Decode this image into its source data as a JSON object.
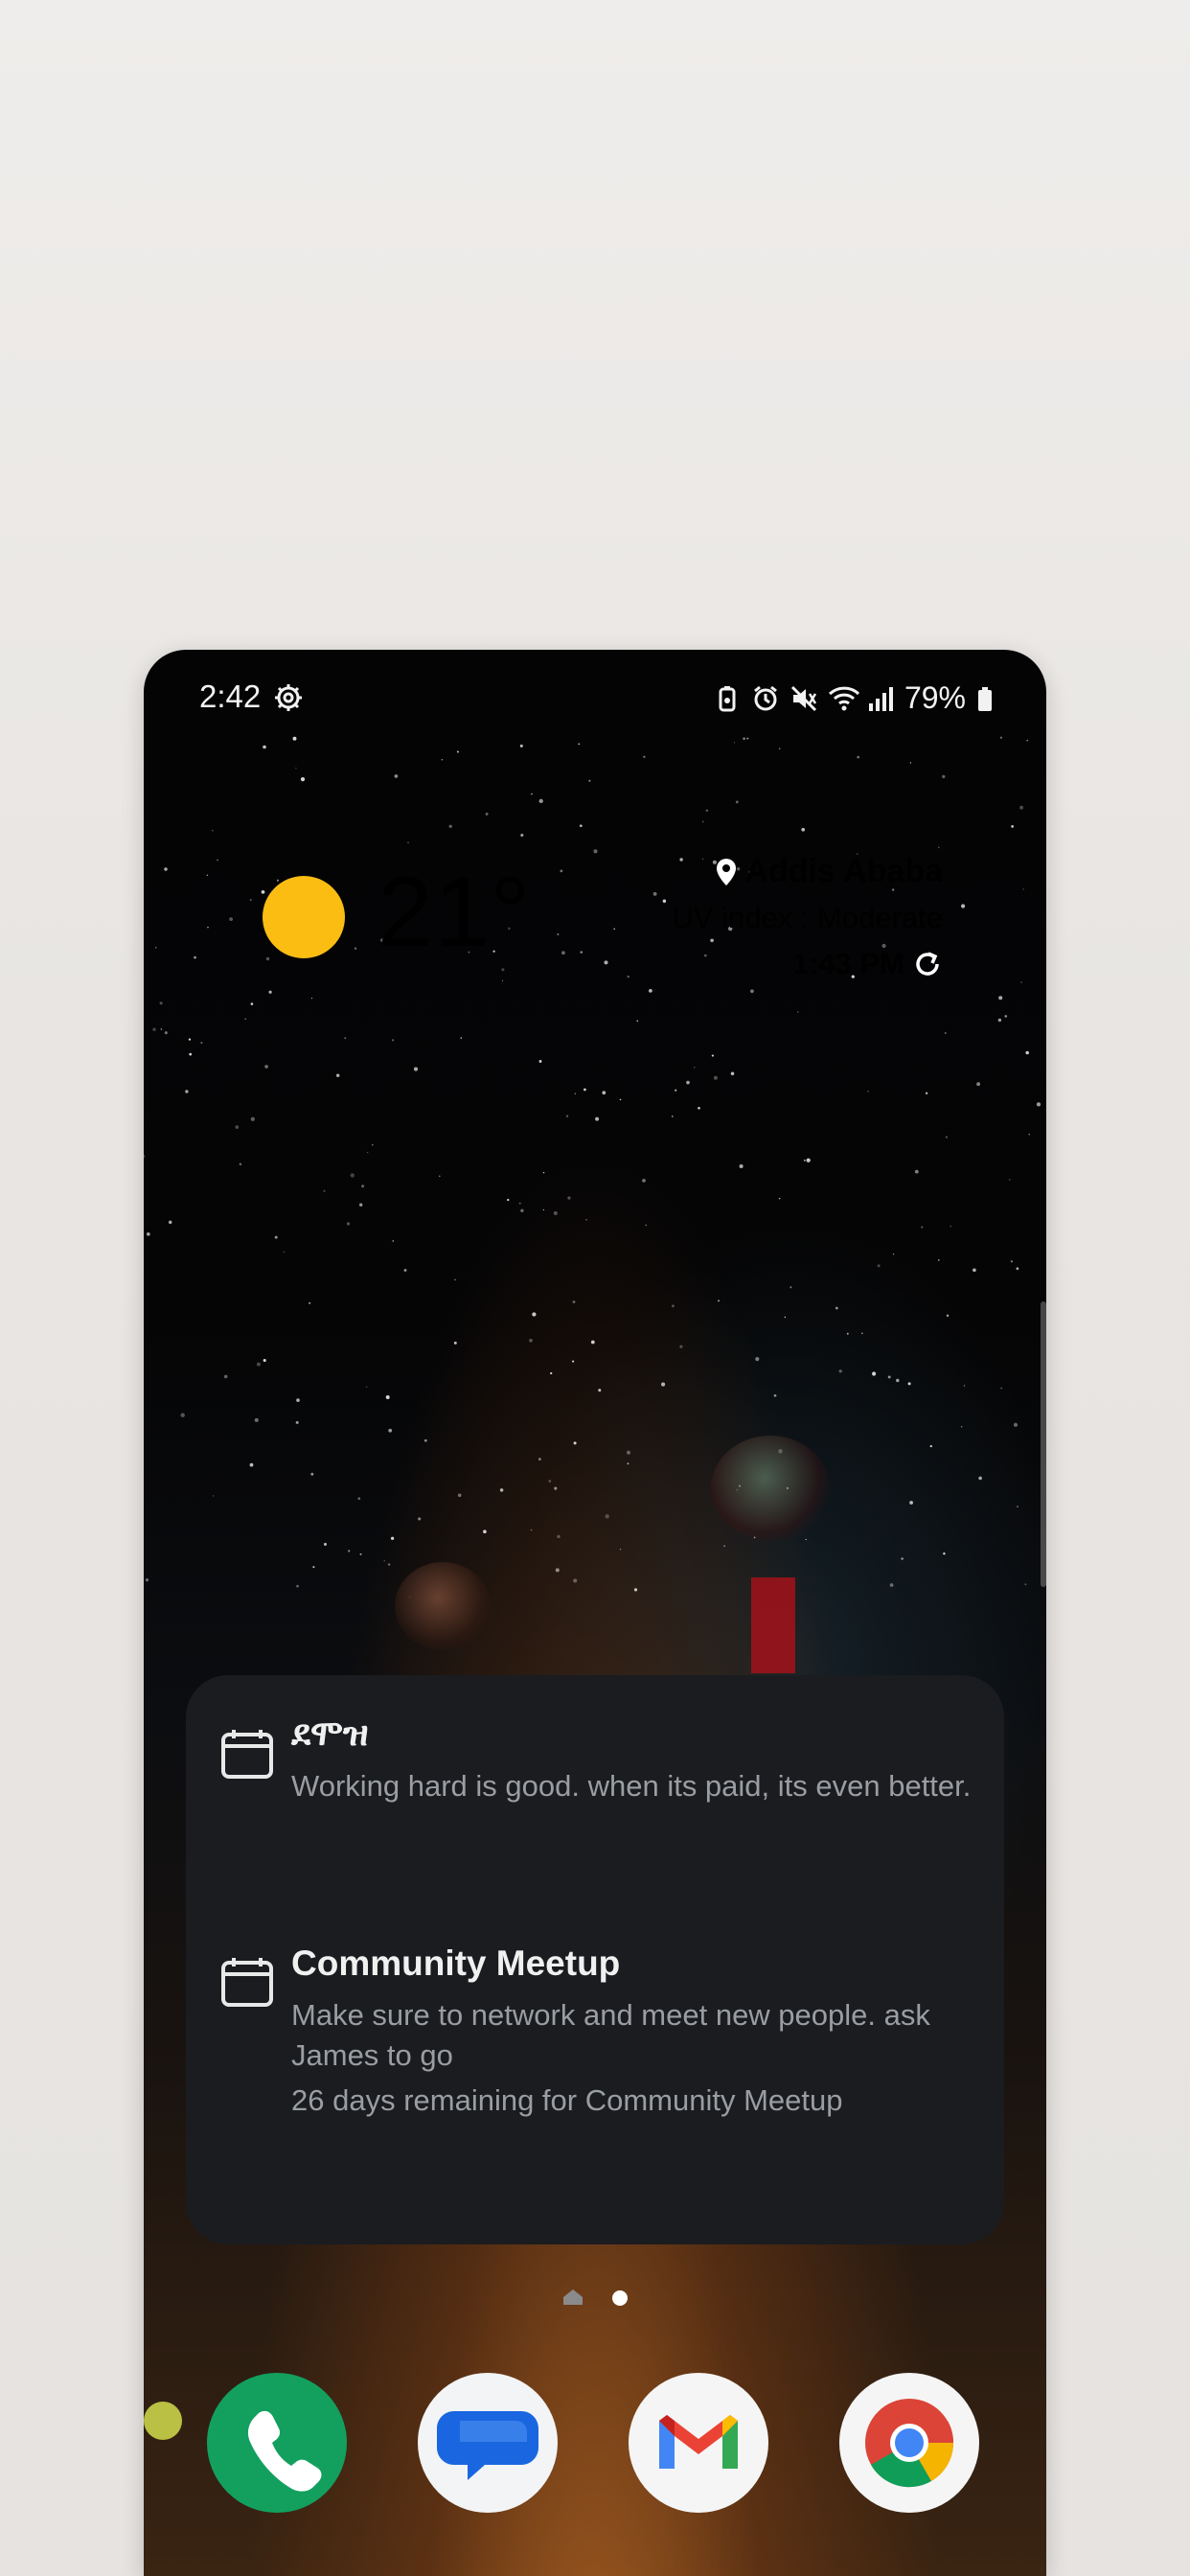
{
  "status_bar": {
    "time": "2:42",
    "battery_percent": "79%",
    "icons": [
      "settings-icon",
      "battery-saver-icon",
      "alarm-icon",
      "mute-icon",
      "wifi-icon",
      "signal-icon",
      "battery-icon"
    ]
  },
  "weather": {
    "temperature": "21°",
    "location": "Addis Ababa",
    "uv_index": "UV index : Moderate",
    "updated_time": "1:43 PM",
    "condition_icon": "sun-icon",
    "sun_color": "#fbbd12"
  },
  "reminders": {
    "items": [
      {
        "title": "ደሞዝ",
        "text": "Working hard is good. when its paid, its even better.",
        "countdown": ""
      },
      {
        "title": "Community Meetup",
        "text": "Make sure to network and meet new people. ask James to go",
        "countdown": "26 days remaining for Community Meetup"
      }
    ]
  },
  "page_indicator": {
    "pages": 2,
    "current": 2
  },
  "dock": {
    "apps": [
      "Phone",
      "Messages",
      "Gmail",
      "Chrome"
    ]
  }
}
